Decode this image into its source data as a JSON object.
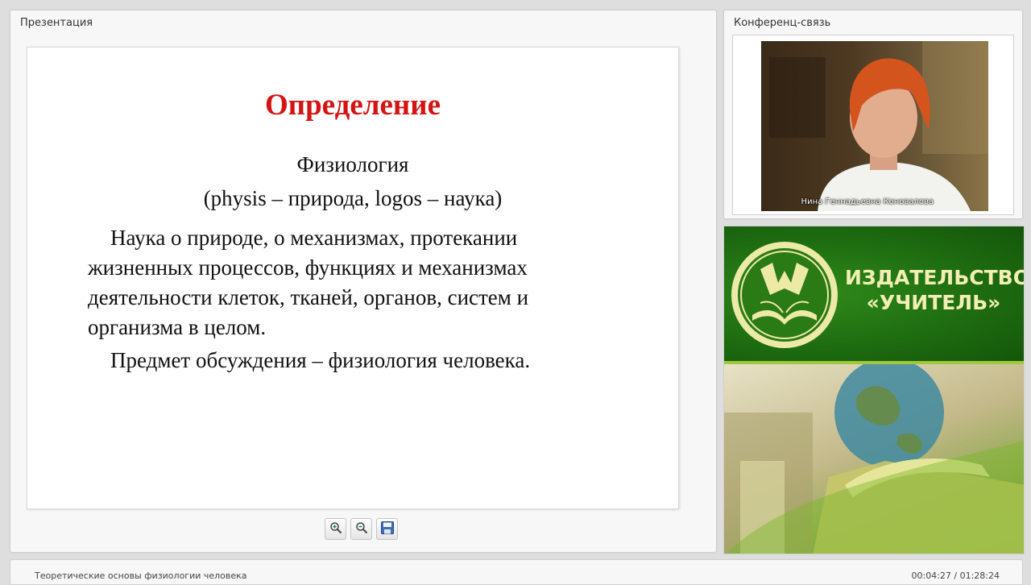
{
  "presentation_panel": {
    "title": "Презентация",
    "slide": {
      "title": "Определение",
      "term": "Физиология",
      "etymology": "(physis – природа, logos – наука)",
      "definition": "Наука о природе, о механизмах, протекании жизненных процессов, функциях и механизмах деятельности клеток, тканей, органов, систем и организма в целом.",
      "subject": "Предмет обсуждения – физиология человека."
    },
    "toolbar": {
      "buttons": [
        {
          "icon": "zoom-in-icon"
        },
        {
          "icon": "zoom-out-icon"
        },
        {
          "icon": "save-icon"
        }
      ]
    }
  },
  "conference_panel": {
    "title": "Конференц-связь",
    "speaker_name": "Нина Геннадьевна Коновалова"
  },
  "banner": {
    "publisher_name": "ИЗДАТЕЛЬСТВО «УЧИТЕЛЬ»"
  },
  "footer": {
    "webinar_title": "Теоретические основы физиологии человека",
    "elapsed": "00:04:27",
    "total": "01:28:24",
    "timer": "00:04:27 / 01:28:24"
  },
  "colors": {
    "slide_title": "#d41414",
    "banner_green": "#1d6a10",
    "banner_text": "#f3efb4"
  }
}
